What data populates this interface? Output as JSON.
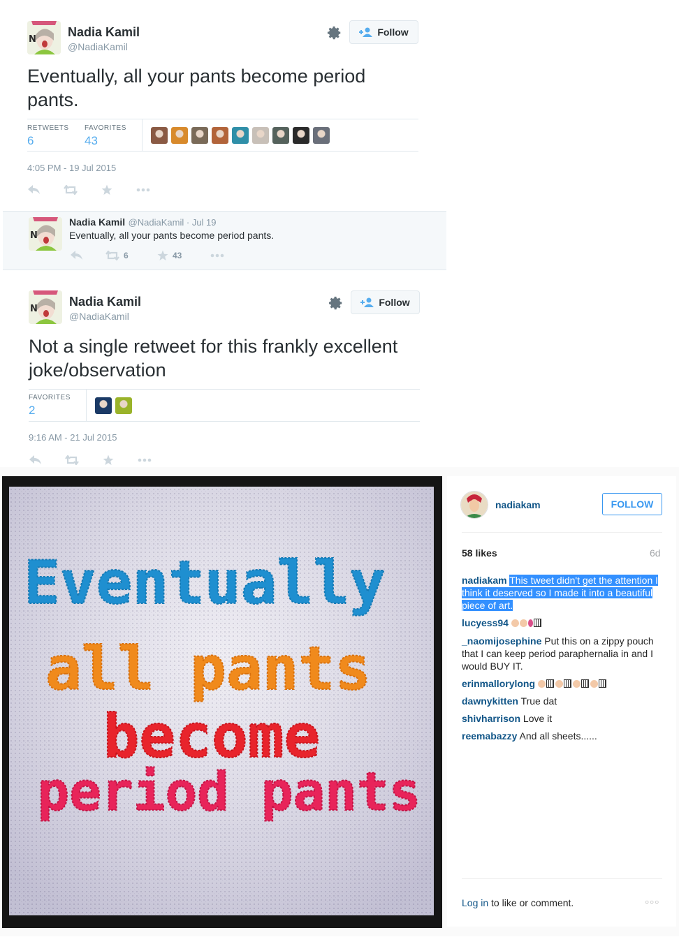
{
  "tweet1": {
    "name": "Nadia Kamil",
    "handle": "@NadiaKamil",
    "follow_label": "Follow",
    "text": "Eventually, all your pants become period pants.",
    "retweets_label": "RETWEETS",
    "retweets": "6",
    "favorites_label": "FAVORITES",
    "favorites": "43",
    "timestamp": "4:05 PM - 19 Jul 2015",
    "favoriter_colors": [
      "#8a5a44",
      "#d88a2c",
      "#7a6a58",
      "#b2643a",
      "#2f8fa8",
      "#c8c0b8",
      "#55625c",
      "#2a2a2a",
      "#6a6f7a"
    ]
  },
  "embed": {
    "name": "Nadia Kamil",
    "meta": "@NadiaKamil · Jul 19",
    "text": "Eventually, all your pants become period pants.",
    "retweets": "6",
    "favorites": "43"
  },
  "tweet2": {
    "name": "Nadia Kamil",
    "handle": "@NadiaKamil",
    "follow_label": "Follow",
    "text": "Not a single retweet for this frankly excellent joke/observation",
    "favorites_label": "FAVORITES",
    "favorites": "2",
    "timestamp": "9:16 AM - 21 Jul 2015",
    "favoriter_colors": [
      "#1b3a66",
      "#9ab32a"
    ]
  },
  "instagram": {
    "username": "nadiakam",
    "follow_label": "FOLLOW",
    "likes": "58 likes",
    "age": "6d",
    "photo_text": {
      "line1": "Eventually",
      "line2": "all pants",
      "line3": "become",
      "line4": "period pants"
    },
    "comments": [
      {
        "user": "nadiakam",
        "text": "This tweet didn't get the attention I think it deserved so I made it into a beautiful piece of art."
      },
      {
        "user": "lucyess94",
        "text": ""
      },
      {
        "user": "_naomijosephine",
        "text": "Put this on a zippy pouch that I can keep period paraphernalia in and I would BUY IT."
      },
      {
        "user": "erinmallorylong",
        "text": ""
      },
      {
        "user": "dawnykitten",
        "text": "True dat"
      },
      {
        "user": "shivharrison",
        "text": "Love it"
      },
      {
        "user": "reemabazzy",
        "text": "And all sheets......"
      }
    ],
    "login_link": "Log in",
    "login_rest": " to like or comment.",
    "more": "○○○"
  },
  "colors": {
    "twitter_blue": "#55acee",
    "ig_blue": "#3897f0",
    "ig_user": "#125688",
    "stitch_blue": "#1f8fd0",
    "stitch_orange": "#f08a1c",
    "stitch_red": "#e8242c",
    "stitch_pink": "#e8245a"
  }
}
